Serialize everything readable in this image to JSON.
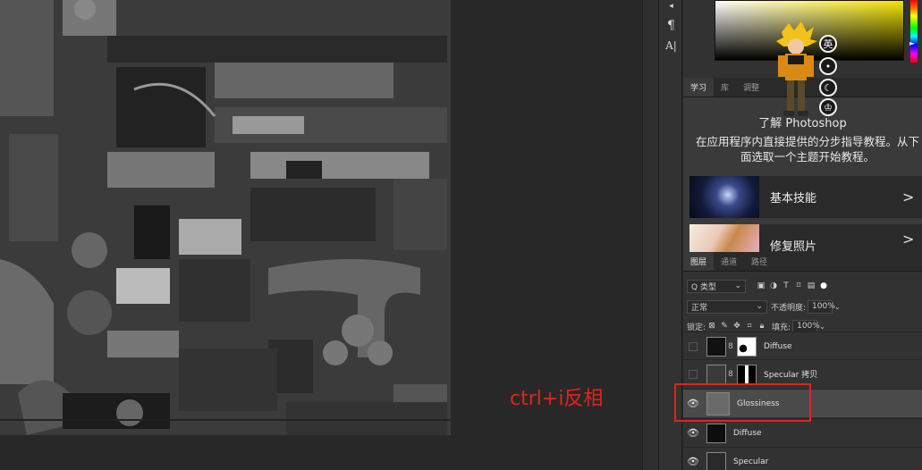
{
  "annotation": "ctrl+i反相",
  "toolbar": {
    "paragraph_glyph": "¶",
    "char_glyph": "A|"
  },
  "mascot": {
    "btn_lang": "英",
    "btn_dot": "•",
    "btn_moon": "☾",
    "btn_shirt": "♔"
  },
  "learn_tabs": [
    "学习",
    "库",
    "调整"
  ],
  "learn": {
    "title": "了解 Photoshop",
    "description": "在应用程序内直接提供的分步指导教程。从下面选取一个主题开始教程。",
    "cards": [
      {
        "label": "基本技能"
      },
      {
        "label": "修复照片"
      }
    ]
  },
  "layer_tabs": [
    "图层",
    "通道",
    "路径"
  ],
  "layers_toolbar": {
    "filter_label": "Q 类型",
    "blend_mode": "正常",
    "opacity_label": "不透明度:",
    "opacity_value": "100%",
    "lock_label": "锁定:",
    "fill_label": "填充:",
    "fill_value": "100%"
  },
  "layers": [
    {
      "name": "Diffuse",
      "visible": false,
      "has_mask": true,
      "selected": false
    },
    {
      "name": "Specular 拷贝",
      "visible": false,
      "has_mask": true,
      "selected": false
    },
    {
      "name": "Glossiness",
      "visible": true,
      "has_mask": false,
      "selected": true
    },
    {
      "name": "Diffuse",
      "visible": true,
      "has_mask": false,
      "selected": false
    },
    {
      "name": "Specular",
      "visible": true,
      "has_mask": false,
      "selected": false
    }
  ],
  "colors": {
    "annotation": "#e0241c",
    "highlight_box": "#e0241c",
    "selected_row": "#4b4b4b"
  }
}
